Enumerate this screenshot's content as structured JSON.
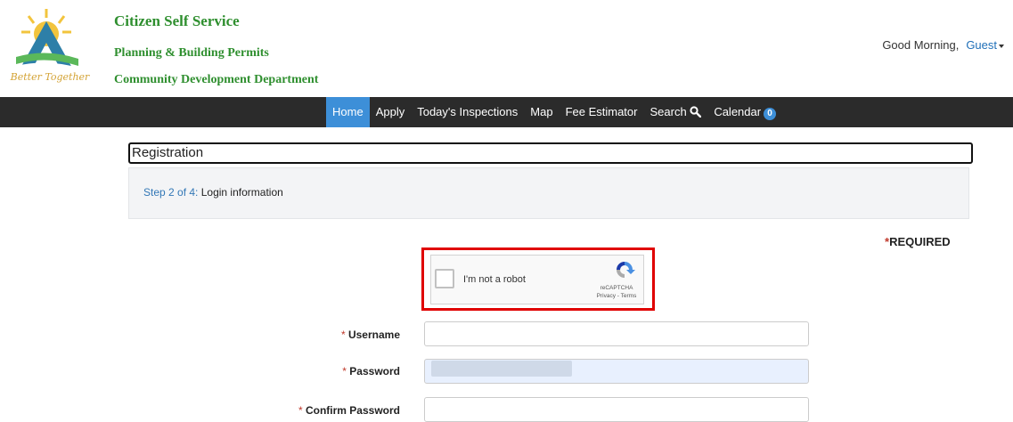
{
  "header": {
    "logo_tagline": "Better Together",
    "title_main": "Citizen Self Service",
    "title_sub": "Planning & Building Permits",
    "title_dept": "Community Development Department",
    "greeting": "Good Morning,",
    "user_link": "Guest"
  },
  "nav": {
    "items": [
      {
        "label": "Home"
      },
      {
        "label": "Apply"
      },
      {
        "label": "Today's Inspections"
      },
      {
        "label": "Map"
      },
      {
        "label": "Fee Estimator"
      },
      {
        "label": "Search"
      },
      {
        "label": "Calendar"
      }
    ],
    "calendar_badge": "0",
    "active_color": "#3d8fd8"
  },
  "registration": {
    "title": "Registration",
    "step_label": "Step 2 of 4:",
    "step_value": "Login information",
    "required_star": "*",
    "required_text": "REQUIRED"
  },
  "captcha": {
    "label": "I'm not a robot",
    "brand": "reCAPTCHA",
    "terms": "Privacy - Terms"
  },
  "form": {
    "username_label": "Username",
    "password_label": "Password",
    "confirm_label": "Confirm Password",
    "username_value": "",
    "password_value": "",
    "confirm_value": ""
  }
}
